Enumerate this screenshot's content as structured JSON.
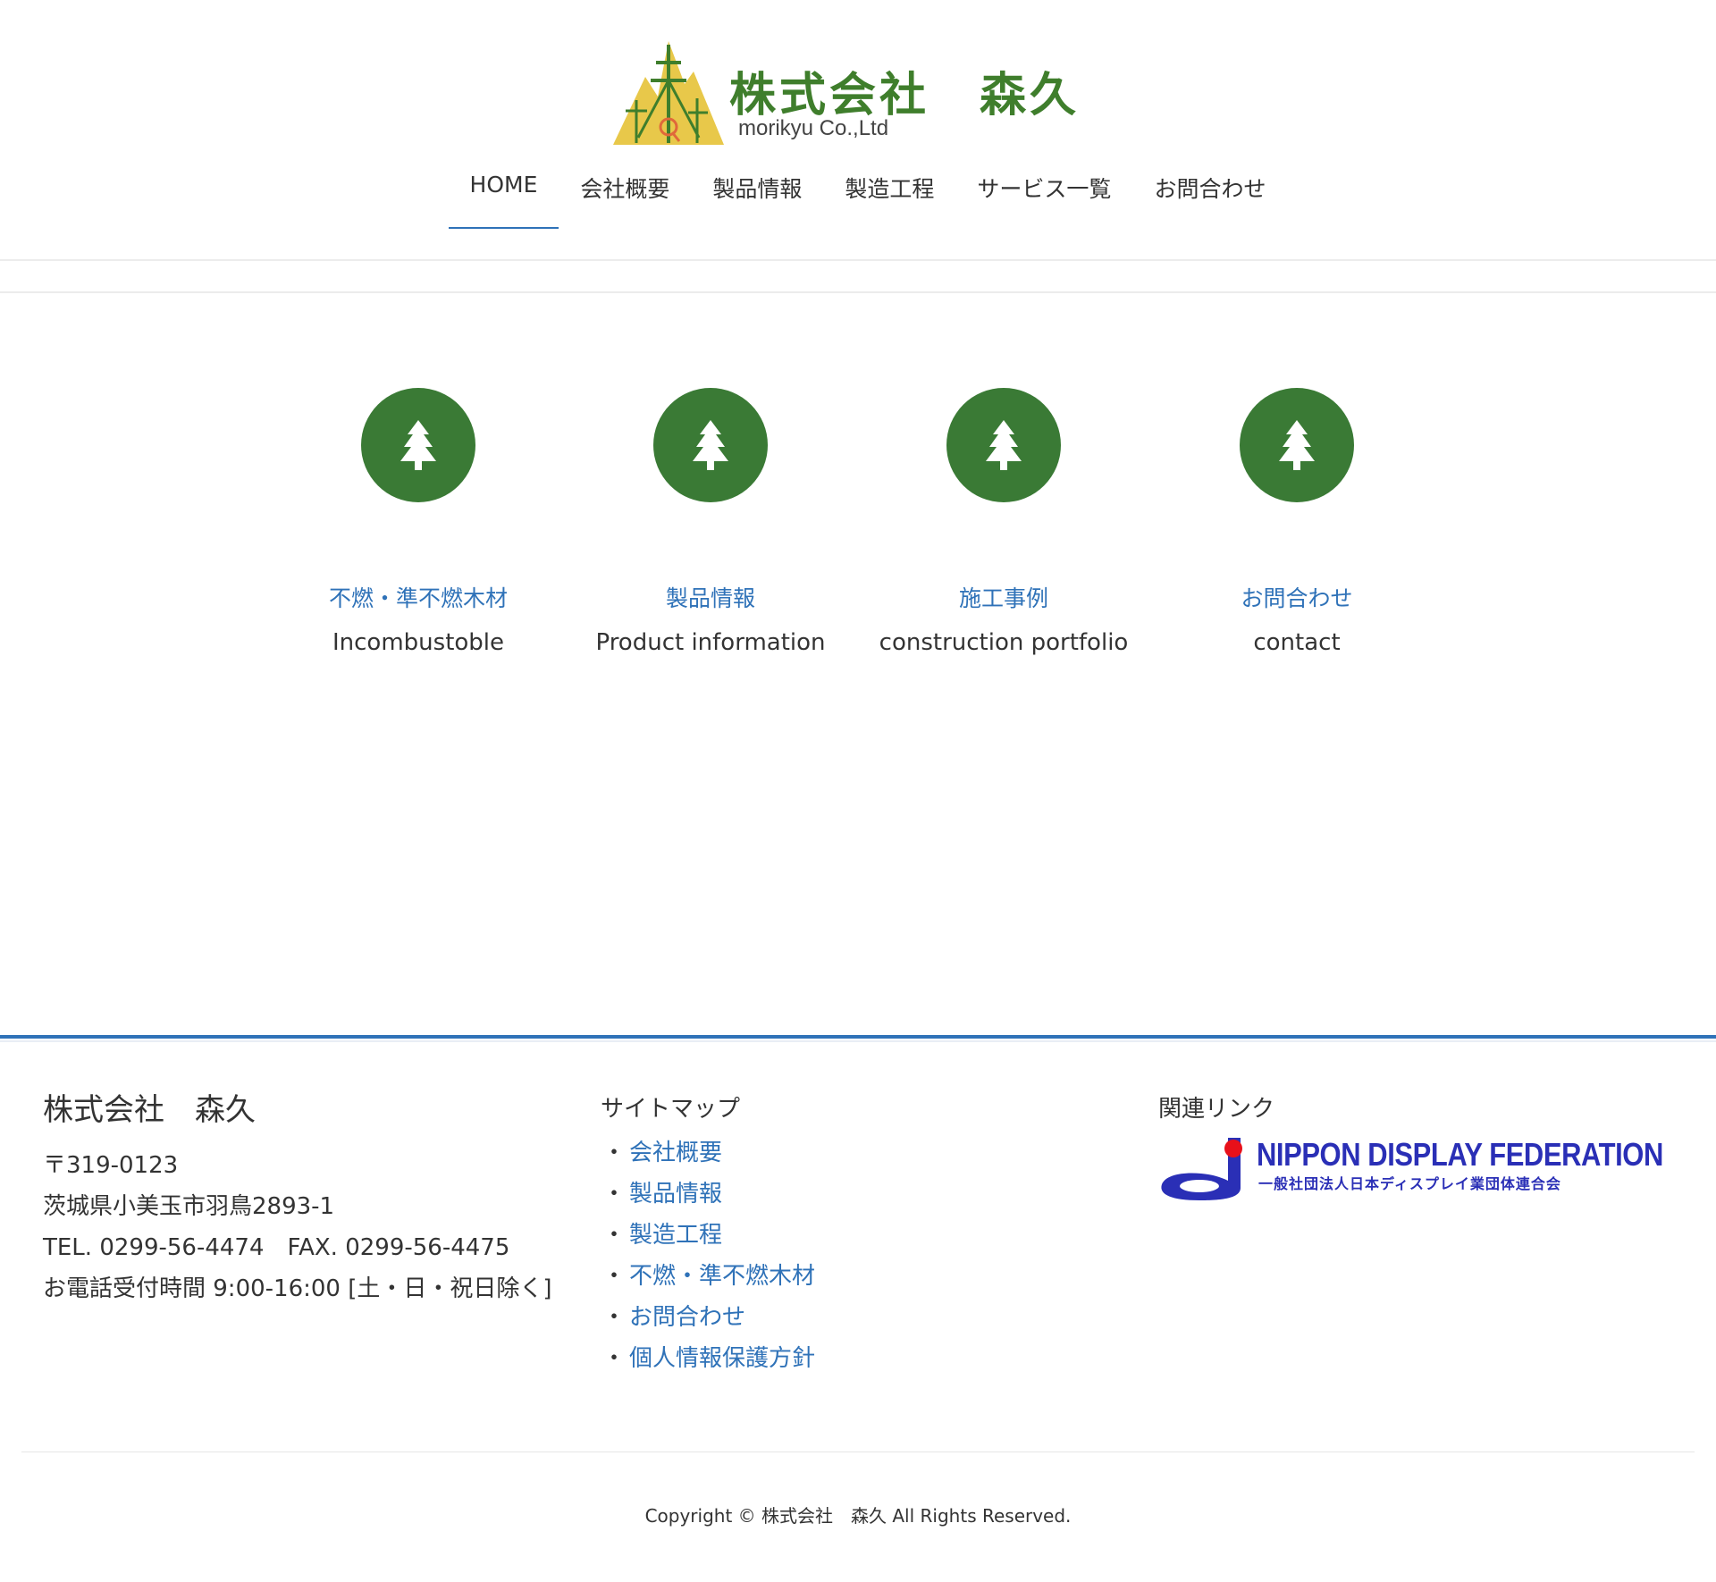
{
  "header": {
    "logo_title": "株式会社　森久",
    "logo_subtitle": "morikyu Co.,Ltd",
    "colors": {
      "logo_green": "#3f7e2c",
      "logo_mountain": "#e8c84a",
      "accent_blue": "#2f72b8"
    }
  },
  "nav": {
    "items": [
      {
        "label": "HOME",
        "active": true
      },
      {
        "label": "会社概要"
      },
      {
        "label": "製品情報"
      },
      {
        "label": "製造工程"
      },
      {
        "label": "サービス一覧"
      },
      {
        "label": "お問合わせ"
      }
    ]
  },
  "features": [
    {
      "icon": "tree-icon",
      "title": "不燃・準不燃木材",
      "subtitle": "Incombustoble"
    },
    {
      "icon": "tree-icon",
      "title": "製品情報",
      "subtitle": "Product information"
    },
    {
      "icon": "tree-icon",
      "title": "施工事例",
      "subtitle": "construction portfolio"
    },
    {
      "icon": "tree-icon",
      "title": "お問合わせ",
      "subtitle": "contact"
    }
  ],
  "footer": {
    "company": {
      "name": "株式会社　森久",
      "postal": "〒319-0123",
      "address": "茨城県小美玉市羽鳥2893-1",
      "phone_fax": "TEL. 0299-56-4474　FAX. 0299-56-4475",
      "hours": "お電話受付時間 9:00-16:00 [土・日・祝日除く]"
    },
    "sitemap": {
      "heading": "サイトマップ",
      "bullet": "・",
      "items": [
        "会社概要",
        "製品情報",
        "製造工程",
        "不燃・準不燃木材",
        "お問合わせ",
        "個人情報保護方針"
      ]
    },
    "related": {
      "heading": "関連リンク",
      "banner_title": "NIPPON DISPLAY FEDERATION",
      "banner_subtitle": "一般社団法人日本ディスプレイ業団体連合会"
    },
    "copyright": "Copyright © 株式会社　森久 All Rights Reserved."
  }
}
